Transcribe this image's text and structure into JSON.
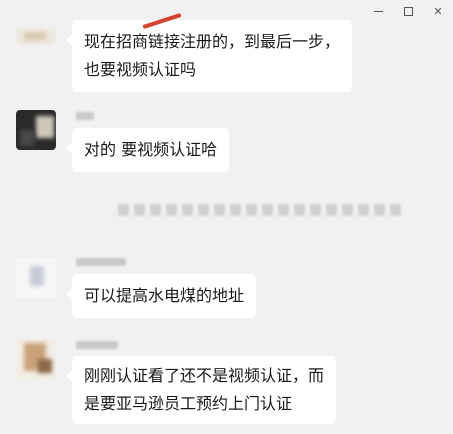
{
  "window_controls": {
    "minimize": "minimize",
    "maximize": "maximize",
    "close": "close"
  },
  "messages": [
    {
      "lines": [
        "现在招商链接注册的，到最后一步，",
        "也要视频认证吗"
      ]
    },
    {
      "lines": [
        "对的 要视频认证哈"
      ]
    },
    {
      "lines": [
        "可以提高水电煤的地址"
      ]
    },
    {
      "lines": [
        "刚刚认证看了还不是视频认证，而",
        "是要亚马逊员工预约上门认证"
      ]
    }
  ],
  "colors": {
    "background": "#f1f1f1",
    "bubble": "#ffffff",
    "text": "#191919",
    "mark": "#d2442e"
  }
}
